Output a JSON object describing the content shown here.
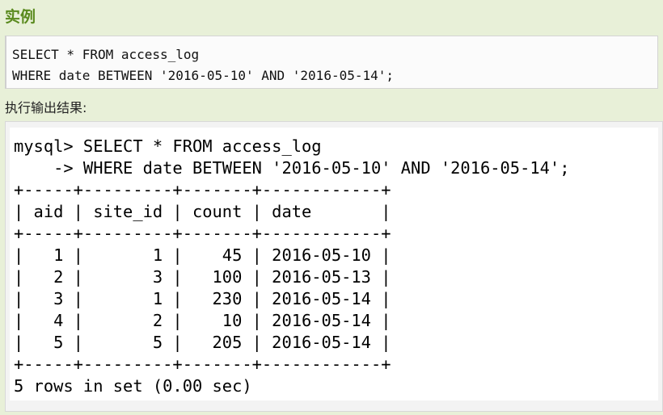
{
  "heading": "实例",
  "sql_code": [
    "SELECT * FROM access_log",
    "WHERE date BETWEEN '2016-05-10' AND '2016-05-14';"
  ],
  "output_label": "执行输出结果:",
  "terminal": {
    "lines": [
      "mysql> SELECT * FROM access_log",
      "    -> WHERE date BETWEEN '2016-05-10' AND '2016-05-14';",
      "+-----+---------+-------+------------+",
      "| aid | site_id | count | date       |",
      "+-----+---------+-------+------------+",
      "|   1 |       1 |    45 | 2016-05-10 |",
      "|   2 |       3 |   100 | 2016-05-13 |",
      "|   3 |       1 |   230 | 2016-05-14 |",
      "|   4 |       2 |    10 | 2016-05-14 |",
      "|   5 |       5 |   205 | 2016-05-14 |",
      "+-----+---------+-------+------------+",
      "5 rows in set (0.00 sec)"
    ]
  }
}
